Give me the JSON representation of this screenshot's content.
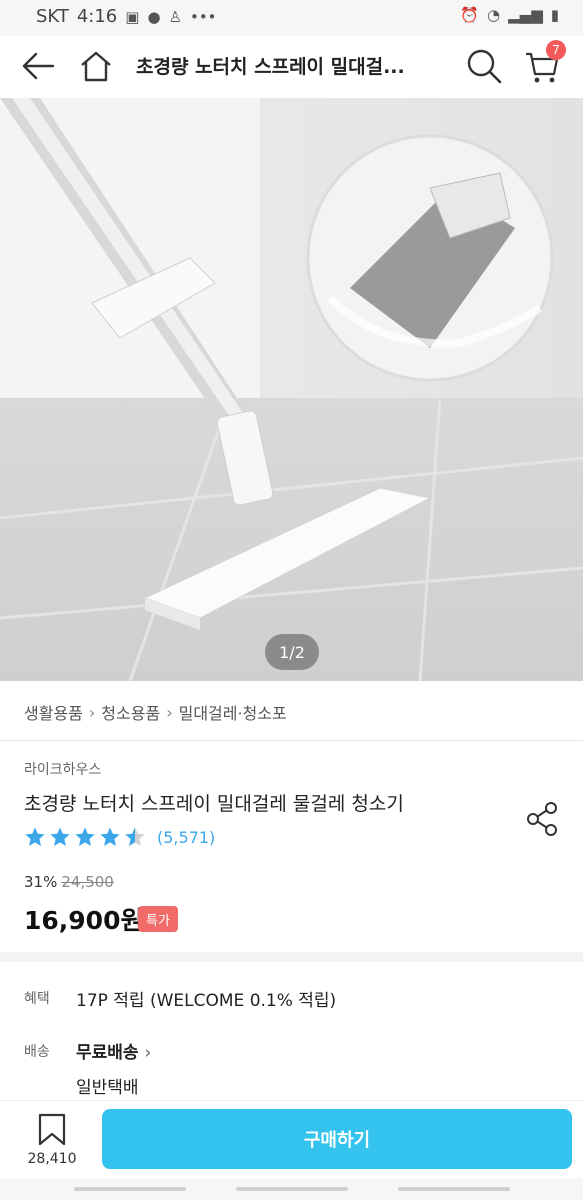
{
  "status_bar": {
    "carrier": "SKT",
    "time": "4:16",
    "more": "•••"
  },
  "header": {
    "title": "초경량 노터치 스프레이 밀대걸...",
    "cart_count": "7"
  },
  "gallery": {
    "pager": "1/2"
  },
  "breadcrumb": [
    "생활용품",
    "청소용품",
    "밀대걸레·청소포"
  ],
  "product": {
    "brand": "라이크하우스",
    "title": "초경량 노터치 스프레이 밀대걸레 물걸레 청소기",
    "rating": 4.5,
    "review_count": "(5,571)",
    "discount": "31%",
    "original_price": "24,500",
    "price": "16,900원",
    "badge": "특가"
  },
  "benefit": {
    "label": "혜택",
    "value": "17P 적립 (WELCOME 0.1% 적립)"
  },
  "shipping": {
    "label": "배송",
    "value": "무료배송",
    "method": "일반택배"
  },
  "bottom_bar": {
    "wish_count": "28,410",
    "buy_label": "구매하기"
  },
  "colors": {
    "accent": "#33c3ee",
    "badge": "#f26b6b",
    "star": "#3ba7e8"
  }
}
